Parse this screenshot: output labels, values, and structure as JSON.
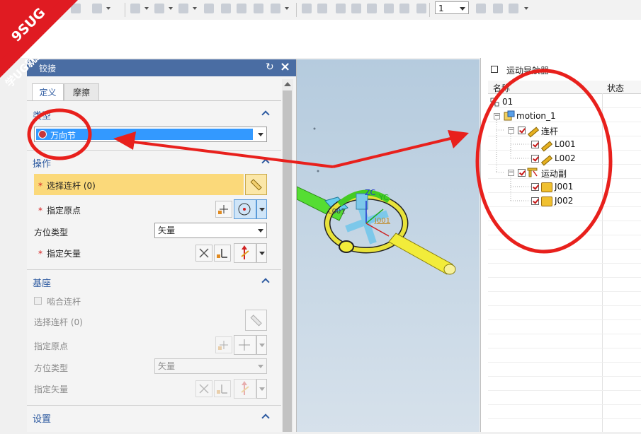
{
  "toolbar": {
    "frame_value": "1"
  },
  "dialog": {
    "title": "铰接",
    "tabs": [
      "定义",
      "摩擦"
    ],
    "type_section": {
      "header": "类型",
      "selected": "万向节"
    },
    "action_section": {
      "header": "操作",
      "select_link": "选择连杆 (0)",
      "specify_origin": "指定原点",
      "orientation_type_label": "方位类型",
      "orientation_type_value": "矢量",
      "specify_vector": "指定矢量"
    },
    "base_section": {
      "header": "基座",
      "mesh_link": "啮合连杆",
      "select_link": "选择连杆 (0)",
      "specify_origin": "指定原点",
      "orientation_type_label": "方位类型",
      "orientation_type_value": "矢量",
      "specify_vector": "指定矢量"
    },
    "settings_section": {
      "header": "设置"
    }
  },
  "viewport": {
    "labels": {
      "zc": "ZC",
      "yc": "YC",
      "l001": "L001",
      "j001": "J001"
    }
  },
  "navigator": {
    "title": "运动导航器",
    "columns": [
      "名称",
      "状态"
    ],
    "tree": {
      "root": "01",
      "sim": "motion_1",
      "links_group": "连杆",
      "links": [
        "L001",
        "L002"
      ],
      "joints_group": "运动副",
      "joints": [
        "J001",
        "J002"
      ]
    }
  },
  "watermark": {
    "line1": "9SUG",
    "line2": "学UG就上UG网",
    "color": "#e01b22"
  }
}
